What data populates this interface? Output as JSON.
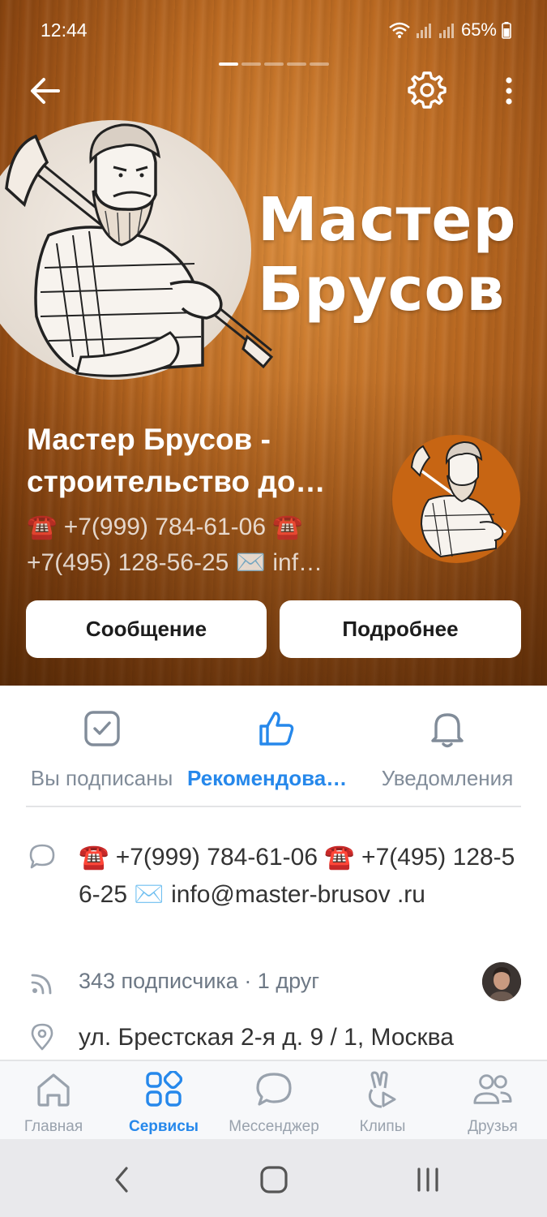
{
  "status_bar": {
    "time": "12:44",
    "battery": "65%"
  },
  "header": {
    "cover_title_line1": "Мастер",
    "cover_title_line2": "Брусов"
  },
  "community": {
    "name_line1": "Мастер Брусов -",
    "name_line2": "строительство до…",
    "status_line1": "☎️ +7(999) 784-61-06 ☎️",
    "status_line2": "+7(495) 128-56-25 ✉️ inf…"
  },
  "actions": {
    "message": "Сообщение",
    "details": "Подробнее"
  },
  "quick_actions": [
    {
      "label": "Вы подписаны",
      "icon": "check-square-icon"
    },
    {
      "label": "Рекомендова…",
      "icon": "thumbs-up-icon"
    },
    {
      "label": "Уведомления",
      "icon": "bell-icon"
    }
  ],
  "info": {
    "status_full": "☎️ +7(999) 784-61-06 ☎️ +7(495) 128-56-25 ✉️ info@master-brusov .ru",
    "subscribers": "343 подписчика · 1 друг",
    "address": "ул. Брестская 2-я д. 9 / 1, Москва"
  },
  "tabbar": [
    {
      "label": "Главная",
      "icon": "home-icon",
      "active": false
    },
    {
      "label": "Сервисы",
      "icon": "services-grid-icon",
      "active": true
    },
    {
      "label": "Мессенджер",
      "icon": "chat-bubble-icon",
      "active": false
    },
    {
      "label": "Клипы",
      "icon": "clips-icon",
      "active": false
    },
    {
      "label": "Друзья",
      "icon": "friends-icon",
      "active": false
    }
  ],
  "colors": {
    "accent": "#2688eb",
    "secondary_text": "#818c99",
    "hero_wood": "#b9661f",
    "avatar_bg": "#c76513"
  }
}
